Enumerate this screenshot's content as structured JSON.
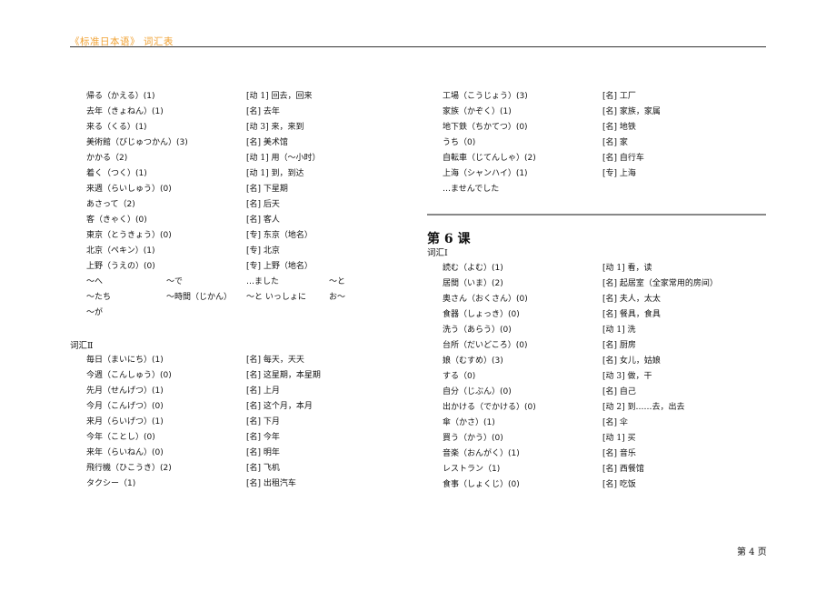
{
  "header": {
    "title": "《标准日本语》  词汇表"
  },
  "left": {
    "entries_a": [
      {
        "jp": "帰る（かえる）(1)",
        "cn": "[动 1] 回去，回来"
      },
      {
        "jp": "去年（きょねん）(1)",
        "cn": "[名] 去年"
      },
      {
        "jp": "来る（くる）(1)",
        "cn": "[动 3] 来，来到"
      },
      {
        "jp": "美術館（びじゅつかん）(3)",
        "cn": "[名] 美术馆"
      },
      {
        "jp": "かかる（2)",
        "cn": "[动 1] 用（～小时）"
      },
      {
        "jp": "着く（つく）(1)",
        "cn": "[动 1] 到，到达"
      },
      {
        "jp": "来週（らいしゅう）(0)",
        "cn": "[名] 下星期"
      },
      {
        "jp": "あさって（2)",
        "cn": "[名] 后天"
      },
      {
        "jp": "客（きゃく）(0)",
        "cn": "[名] 客人"
      },
      {
        "jp": "東京（とうきょう）(0)",
        "cn": "[专] 东京（地名）"
      },
      {
        "jp": "北京（ペキン）(1)",
        "cn": "[专] 北京"
      },
      {
        "jp": "上野（うえの）(0)",
        "cn": "[专] 上野（地名）"
      }
    ],
    "particles": [
      [
        "～へ",
        "～で",
        "…ました",
        "～と"
      ],
      [
        "～たち",
        "～時間（じかん）",
        "～と いっしょに",
        "お～"
      ],
      [
        "～が",
        "",
        "",
        ""
      ]
    ],
    "section2_label": "词汇Ⅱ",
    "entries_b": [
      {
        "jp": "毎日（まいにち）(1)",
        "cn": "[名] 每天，天天"
      },
      {
        "jp": "今週（こんしゅう）(0)",
        "cn": "[名] 这星期，本星期"
      },
      {
        "jp": "先月（せんげつ）(1)",
        "cn": "[名] 上月"
      },
      {
        "jp": "今月（こんげつ）(0)",
        "cn": "[名] 这个月，本月"
      },
      {
        "jp": "来月（らいげつ）(1)",
        "cn": "[名] 下月"
      },
      {
        "jp": "今年（ことし）(0)",
        "cn": "[名] 今年"
      },
      {
        "jp": "来年（らいねん）(0)",
        "cn": "[名] 明年"
      },
      {
        "jp": "飛行機（ひこうき）(2)",
        "cn": "[名] 飞机"
      },
      {
        "jp": "タクシー（1)",
        "cn": "[名] 出租汽车"
      }
    ]
  },
  "right": {
    "entries_a": [
      {
        "jp": "工場（こうじょう）(3)",
        "cn": "[名] 工厂"
      },
      {
        "jp": "家族（かぞく）(1)",
        "cn": "[名] 家族，家属"
      },
      {
        "jp": "地下鉄（ちかてつ）(0)",
        "cn": "[名] 地铁"
      },
      {
        "jp": "うち（0)",
        "cn": "[名] 家"
      },
      {
        "jp": "自転車（じてんしゃ）(2)",
        "cn": "[名] 自行车"
      },
      {
        "jp": "上海（シャンハイ）(1)",
        "cn": "[专] 上海"
      },
      {
        "jp": "…ませんでした",
        "cn": ""
      }
    ],
    "lesson_title": "第 6 课",
    "section1_label": "词汇Ⅰ",
    "entries_b": [
      {
        "jp": "読む（よむ）(1)",
        "cn": "[动 1] 看，读"
      },
      {
        "jp": "居間（いま）(2)",
        "cn": "[名] 起居室（全家常用的房间）"
      },
      {
        "jp": "奥さん（おくさん）(0)",
        "cn": "[名] 夫人，太太"
      },
      {
        "jp": "食器（しょっき）(0)",
        "cn": "[名] 餐具，食具"
      },
      {
        "jp": "洗う（あらう）(0)",
        "cn": "[动 1] 洗"
      },
      {
        "jp": "台所（だいどころ）(0)",
        "cn": "[名] 厨房"
      },
      {
        "jp": "娘（むすめ）(3)",
        "cn": "[名] 女儿，姑娘"
      },
      {
        "jp": "する（0)",
        "cn": "[动 3] 做，干"
      },
      {
        "jp": "自分（じぶん）(0)",
        "cn": "[名] 自己"
      },
      {
        "jp": "出かける（でかける）(0)",
        "cn": "[动 2] 到……去，出去"
      },
      {
        "jp": "傘（かさ）(1)",
        "cn": "[名] 伞"
      },
      {
        "jp": "買う（かう）(0)",
        "cn": "[动 1] 买"
      },
      {
        "jp": "音楽（おんがく）(1)",
        "cn": "[名] 音乐"
      },
      {
        "jp": "レストラン（1)",
        "cn": "[名] 西餐馆"
      },
      {
        "jp": "食事（しょくじ）(0)",
        "cn": "[名] 吃饭"
      }
    ]
  },
  "footer": {
    "page": "第 4 页"
  }
}
